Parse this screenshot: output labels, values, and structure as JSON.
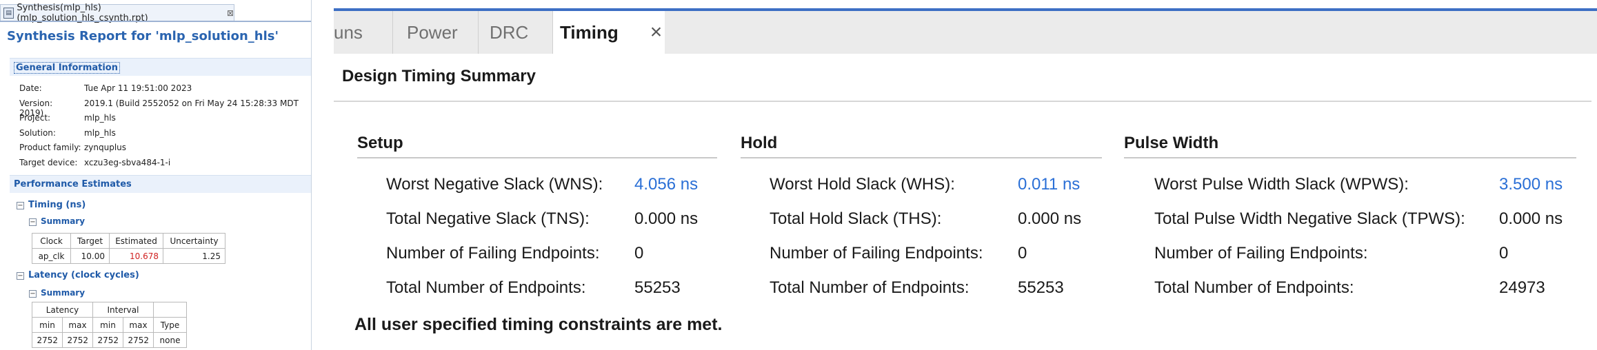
{
  "left": {
    "tab_title": "Synthesis(mlp_hls)(mlp_solution_hls_csynth.rpt)",
    "tab_icon": "report-file-icon",
    "page_title": "Synthesis Report for 'mlp_solution_hls'",
    "general": {
      "title": "General Information",
      "rows": [
        {
          "k": "Date:",
          "v": "Tue Apr 11 19:51:00 2023"
        },
        {
          "k": "Version:",
          "v": "2019.1 (Build 2552052 on Fri May 24 15:28:33 MDT 2019)"
        },
        {
          "k": "Project:",
          "v": "mlp_hls"
        },
        {
          "k": "Solution:",
          "v": "mlp_hls"
        },
        {
          "k": "Product family:",
          "v": "zynquplus"
        },
        {
          "k": "Target device:",
          "v": "xczu3eg-sbva484-1-i"
        }
      ]
    },
    "performance": {
      "title": "Performance Estimates",
      "timing_label": "Timing (ns)",
      "timing_summary_label": "Summary",
      "timing_headers": [
        "Clock",
        "Target",
        "Estimated",
        "Uncertainty"
      ],
      "timing_row": [
        "ap_clk",
        "10.00",
        "10.678",
        "1.25"
      ],
      "latency_label": "Latency (clock cycles)",
      "latency_summary_label": "Summary",
      "latency_group_headers": [
        "Latency",
        "Interval"
      ],
      "latency_headers": [
        "min",
        "max",
        "min",
        "max",
        "Type"
      ],
      "latency_row": [
        "2752",
        "2752",
        "2752",
        "2752",
        "none"
      ]
    }
  },
  "right": {
    "tabs": [
      {
        "label": "uns",
        "active": false
      },
      {
        "label": "Power",
        "active": false
      },
      {
        "label": "DRC",
        "active": false
      },
      {
        "label": "Timing",
        "active": true
      }
    ],
    "close_glyph": "×",
    "title": "Design Timing Summary",
    "columns": [
      {
        "heading": "Setup",
        "rows": [
          {
            "label": "Worst Negative Slack (WNS):",
            "value": "4.056 ns",
            "link": true
          },
          {
            "label": "Total Negative Slack (TNS):",
            "value": "0.000 ns",
            "link": false
          },
          {
            "label": "Number of Failing Endpoints:",
            "value": "0",
            "link": false
          },
          {
            "label": "Total Number of Endpoints:",
            "value": "55253",
            "link": false
          }
        ]
      },
      {
        "heading": "Hold",
        "rows": [
          {
            "label": "Worst Hold Slack (WHS):",
            "value": "0.011 ns",
            "link": true
          },
          {
            "label": "Total Hold Slack (THS):",
            "value": "0.000 ns",
            "link": false
          },
          {
            "label": "Number of Failing Endpoints:",
            "value": "0",
            "link": false
          },
          {
            "label": "Total Number of Endpoints:",
            "value": "55253",
            "link": false
          }
        ]
      },
      {
        "heading": "Pulse Width",
        "rows": [
          {
            "label": "Worst Pulse Width Slack (WPWS):",
            "value": "3.500 ns",
            "link": true
          },
          {
            "label": "Total Pulse Width Negative Slack (TPWS):",
            "value": "0.000 ns",
            "link": false
          },
          {
            "label": "Number of Failing Endpoints:",
            "value": "0",
            "link": false
          },
          {
            "label": "Total Number of Endpoints:",
            "value": "24973",
            "link": false
          }
        ]
      }
    ],
    "status_message": "All user specified timing constraints are met.",
    "colors": {
      "accent": "#3d6fc4",
      "link": "#2a6fd6",
      "violation": "#d02020"
    }
  }
}
